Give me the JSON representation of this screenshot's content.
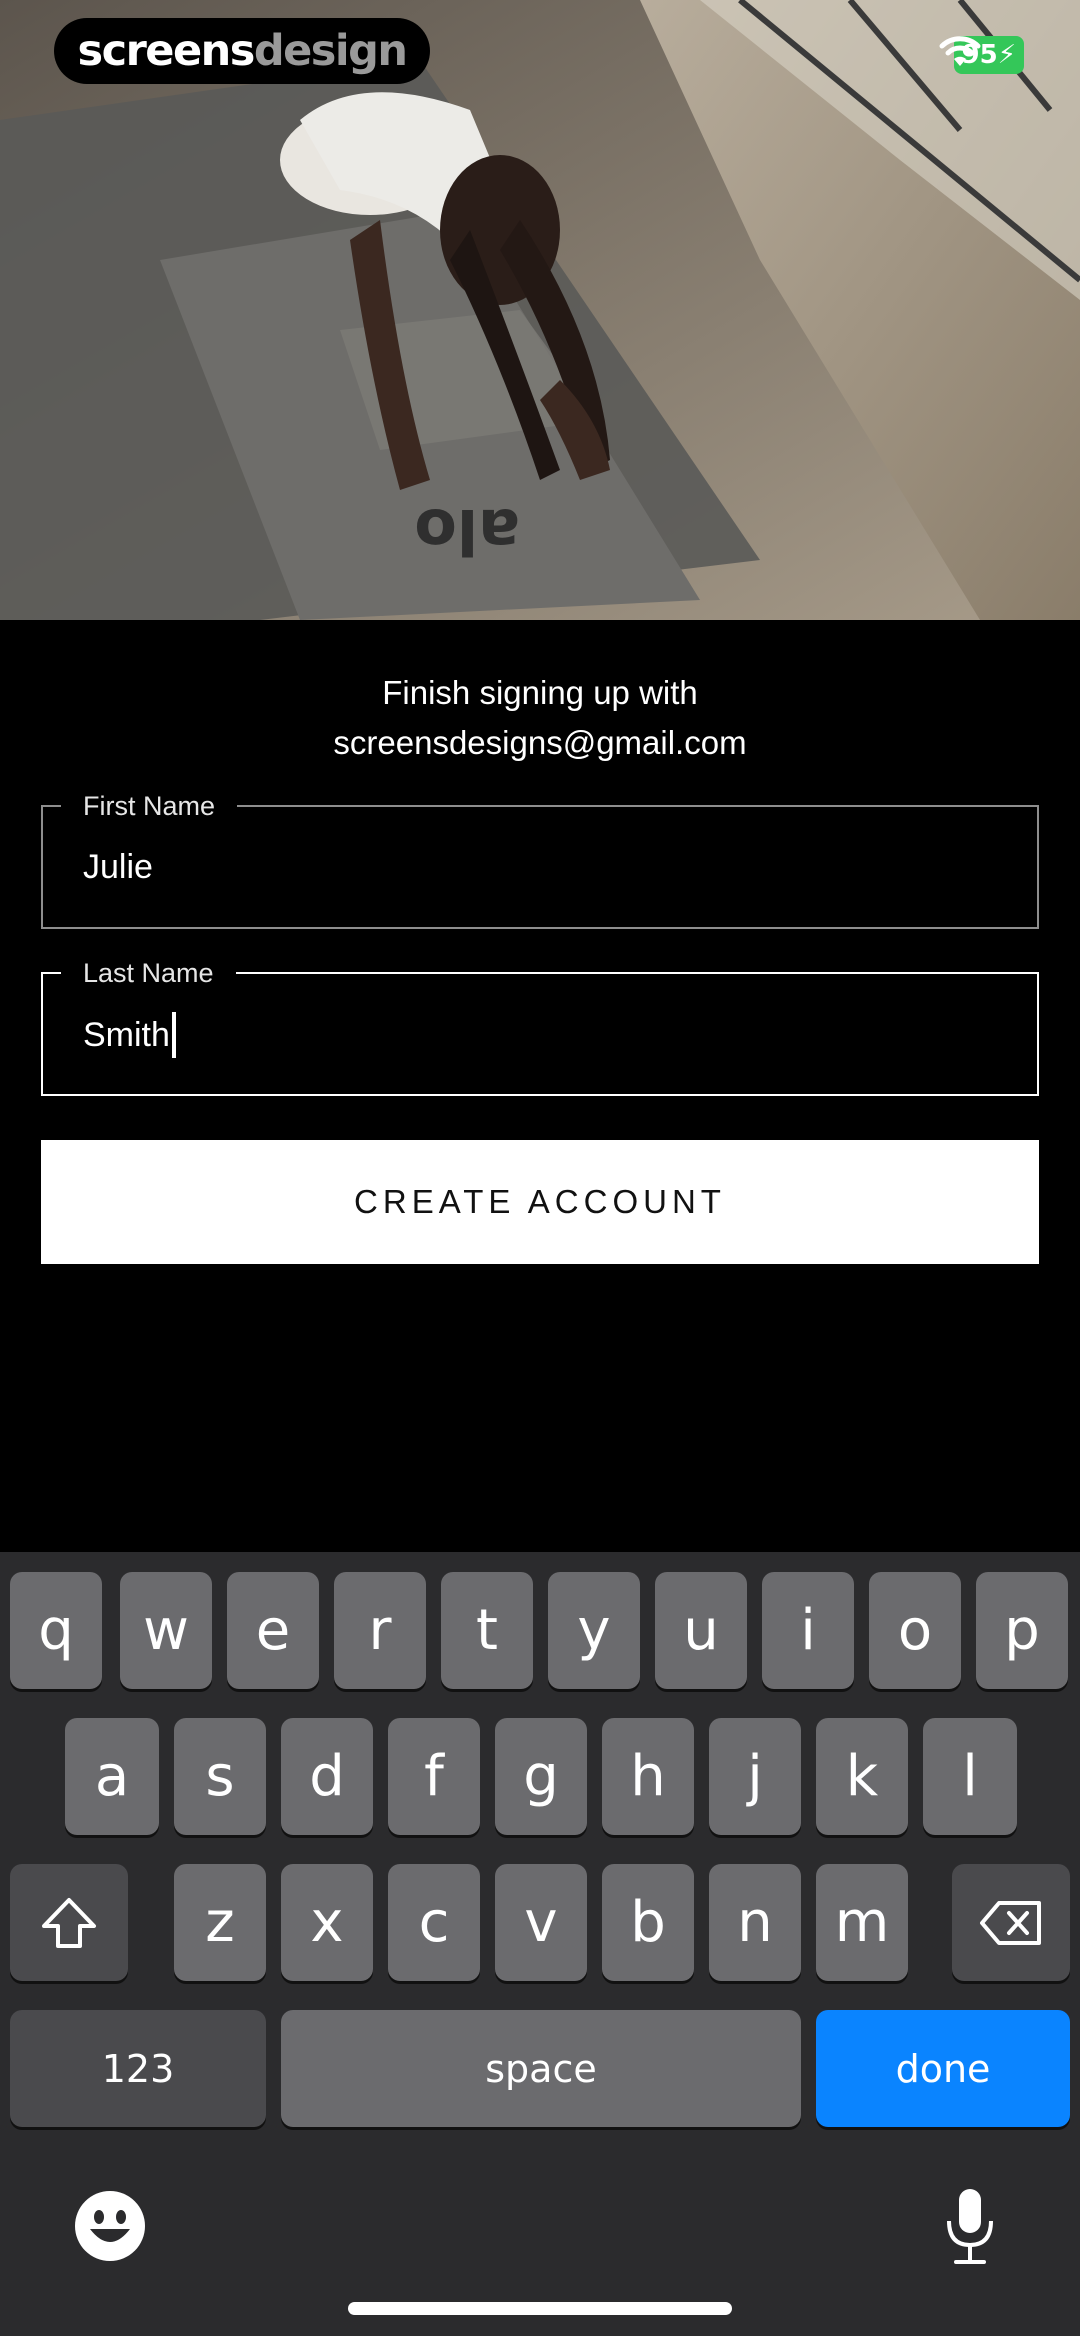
{
  "watermark": {
    "part_a": "screens",
    "part_b": "design"
  },
  "status": {
    "battery": "95",
    "wifi_icon": "wifi-icon"
  },
  "hero": {
    "mat_logo": "alo"
  },
  "form": {
    "heading_line1": "Finish signing up with",
    "heading_line2": "screensdesigns@gmail.com",
    "first_name": {
      "label": "First Name",
      "value": "Julie"
    },
    "last_name": {
      "label": "Last Name",
      "value": "Smith"
    },
    "create_button": "CREATE ACCOUNT"
  },
  "keyboard": {
    "row1": [
      "q",
      "w",
      "e",
      "r",
      "t",
      "y",
      "u",
      "i",
      "o",
      "p"
    ],
    "row2": [
      "a",
      "s",
      "d",
      "f",
      "g",
      "h",
      "j",
      "k",
      "l"
    ],
    "row3": [
      "z",
      "x",
      "c",
      "v",
      "b",
      "n",
      "m"
    ],
    "numbers": "123",
    "space": "space",
    "done": "done",
    "icons": {
      "shift": "shift-icon",
      "delete": "backspace-icon",
      "emoji": "emoji-icon",
      "mic": "microphone-icon"
    }
  },
  "colors": {
    "accent": "#0a84ff",
    "battery": "#34c759",
    "keyboard_bg": "#2b2b2d",
    "key": "#6b6b6e"
  }
}
